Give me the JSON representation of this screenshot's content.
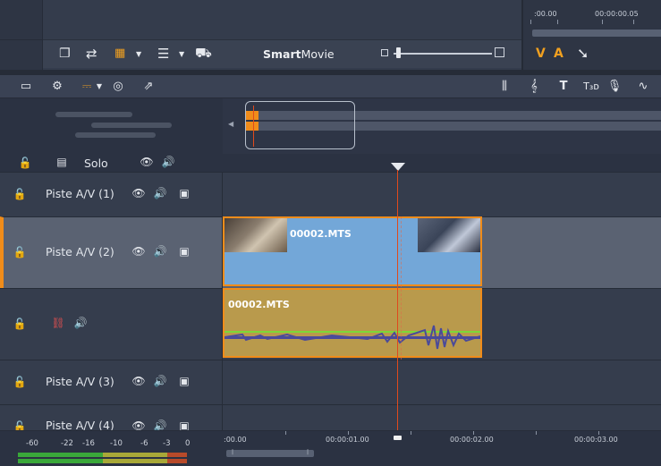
{
  "library": {
    "smartmovie_smart": "Smart",
    "smartmovie_movie": "Movie"
  },
  "player": {
    "ruler_labels": [
      ":00.00",
      "00:00:00.05"
    ],
    "title_v": "V",
    "title_a": "A"
  },
  "header": {
    "solo_label": "Solo"
  },
  "tracks": [
    {
      "name": "Piste A/V (1)"
    },
    {
      "name": "Piste A/V (2)"
    },
    {
      "name": ""
    },
    {
      "name": "Piste A/V (3)"
    },
    {
      "name": "Piste A/V (4)"
    }
  ],
  "clips": {
    "video_name": "00002.MTS",
    "audio_name": "00002.MTS"
  },
  "ruler": {
    "labels": [
      ":00.00",
      "00:00:01.00",
      "00:00:02.00",
      "00:00:03.00"
    ]
  },
  "meter": {
    "labels": [
      "-60",
      "-22",
      "-16",
      "-10",
      "-6",
      "-3",
      "0"
    ]
  },
  "colors": {
    "accent": "#f08c1a",
    "video_clip": "#73a7d8",
    "audio_clip": "#b99a4c",
    "playhead": "#e04a1c"
  }
}
